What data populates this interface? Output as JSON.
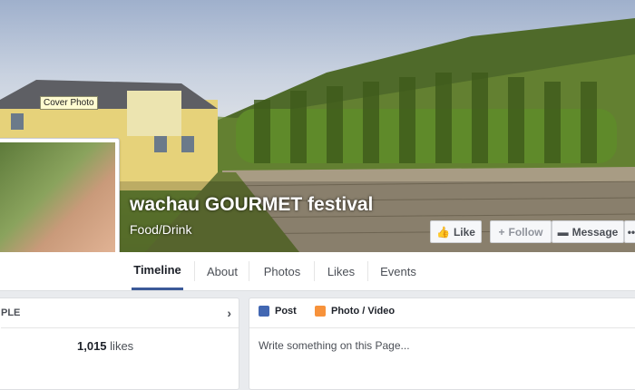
{
  "cover": {
    "tooltip": "Cover Photo"
  },
  "page": {
    "name": "wachau GOURMET festival",
    "category": "Food/Drink"
  },
  "actions": {
    "like": "Like",
    "follow": "Follow",
    "message": "Message",
    "more": "•••"
  },
  "tabs": [
    "Timeline",
    "About",
    "Photos",
    "Likes",
    "Events"
  ],
  "left": {
    "section_title": "PLE",
    "likes_count": "1,015",
    "likes_label": "likes"
  },
  "composer": {
    "post": "Post",
    "photo_video": "Photo / Video",
    "placeholder": "Write something on this Page..."
  },
  "colors": {
    "brand": "#3b5998",
    "bg": "#e9ebee"
  }
}
